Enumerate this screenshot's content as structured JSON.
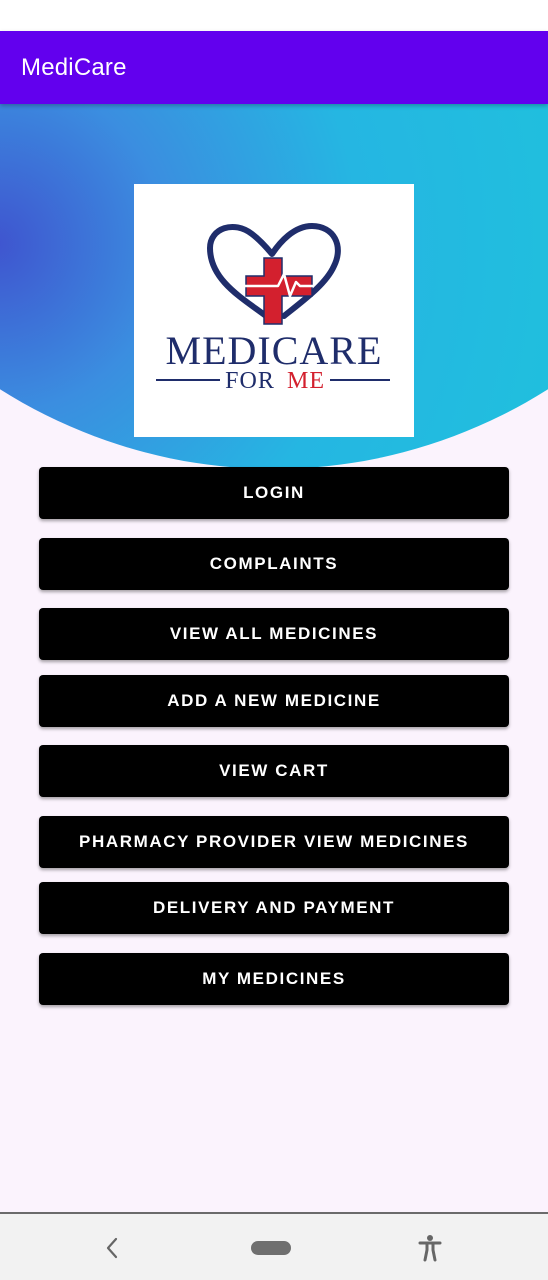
{
  "app": {
    "title": "MediCare"
  },
  "logo": {
    "line1": "MEDICARE",
    "line2a": "FOR",
    "line2b": "ME"
  },
  "menu": [
    {
      "label": "LOGIN"
    },
    {
      "label": "COMPLAINTS"
    },
    {
      "label": "VIEW ALL MEDICINES"
    },
    {
      "label": "ADD A NEW MEDICINE"
    },
    {
      "label": "VIEW CART"
    },
    {
      "label": "PHARMACY PROVIDER VIEW MEDICINES"
    },
    {
      "label": "DELIVERY AND PAYMENT"
    },
    {
      "label": "MY MEDICINES"
    }
  ],
  "colors": {
    "app_bar": "#6200ee",
    "button": "#000000",
    "logo_navy": "#1f2d6b",
    "logo_red": "#d3202e"
  },
  "nav": {
    "icons": [
      "back-icon",
      "home-pill-icon",
      "accessibility-icon"
    ]
  }
}
